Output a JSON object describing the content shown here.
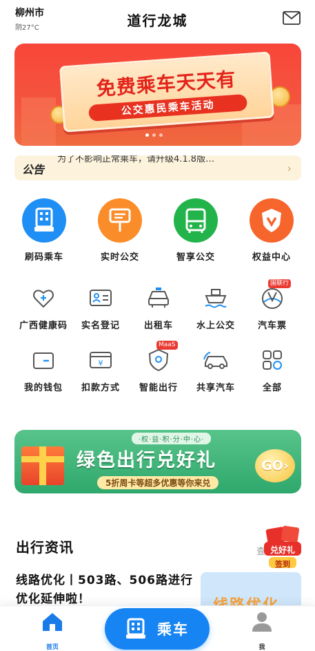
{
  "header": {
    "city": "柳州市",
    "weather": "阴27°C",
    "title": "道行龙城",
    "mail_icon": "mail-icon"
  },
  "banner": {
    "headline": "免费乘车天天有",
    "subline": "公交惠民乘车活动",
    "page_count": 3,
    "active_page": 1,
    "color": "#f4553f"
  },
  "notice": {
    "tag": "公告",
    "text": "为了不影响正常乘车，请升级4.1.8版…"
  },
  "main_services": [
    {
      "label": "刷码乘车",
      "icon": "qr-bus-icon",
      "color": "#1f8ff5"
    },
    {
      "label": "实时公交",
      "icon": "bus-stop-icon",
      "color": "#fa8d2a"
    },
    {
      "label": "智享公交",
      "icon": "bus-front-icon",
      "color": "#22b34a"
    },
    {
      "label": "权益中心",
      "icon": "shield-v-icon",
      "color": "#f6652c"
    }
  ],
  "services": [
    {
      "label": "广西健康码",
      "icon": "heart-plus-icon"
    },
    {
      "label": "实名登记",
      "icon": "id-card-icon"
    },
    {
      "label": "出租车",
      "icon": "taxi-icon"
    },
    {
      "label": "水上公交",
      "icon": "ferry-icon"
    },
    {
      "label": "汽车票",
      "icon": "coach-ticket-icon",
      "badge": "国联行"
    },
    {
      "label": "我的钱包",
      "icon": "wallet-icon"
    },
    {
      "label": "扣款方式",
      "icon": "yuan-card-icon"
    },
    {
      "label": "智能出行",
      "icon": "location-shield-icon",
      "badge": "MaaS"
    },
    {
      "label": "共享汽车",
      "icon": "shared-car-icon"
    },
    {
      "label": "全部",
      "icon": "all-grid-icon"
    }
  ],
  "promo": {
    "top_tag": "·权·益·积·分·中·心·",
    "headline": "绿色出行兑好礼",
    "subline": "5折周卡等超多优惠等你来兑",
    "go": "GO›",
    "color": "#2fa86d"
  },
  "news": {
    "section_title": "出行资讯",
    "more": "查",
    "headline": "线路优化丨503路、506路进行优化延伸啦！",
    "thumb_text": "线路优化"
  },
  "floating_gift": {
    "line1": "兑好礼",
    "line2": "签到"
  },
  "tabbar": {
    "home_label": "首页",
    "ride_label": "乘车",
    "me_label": "我"
  }
}
